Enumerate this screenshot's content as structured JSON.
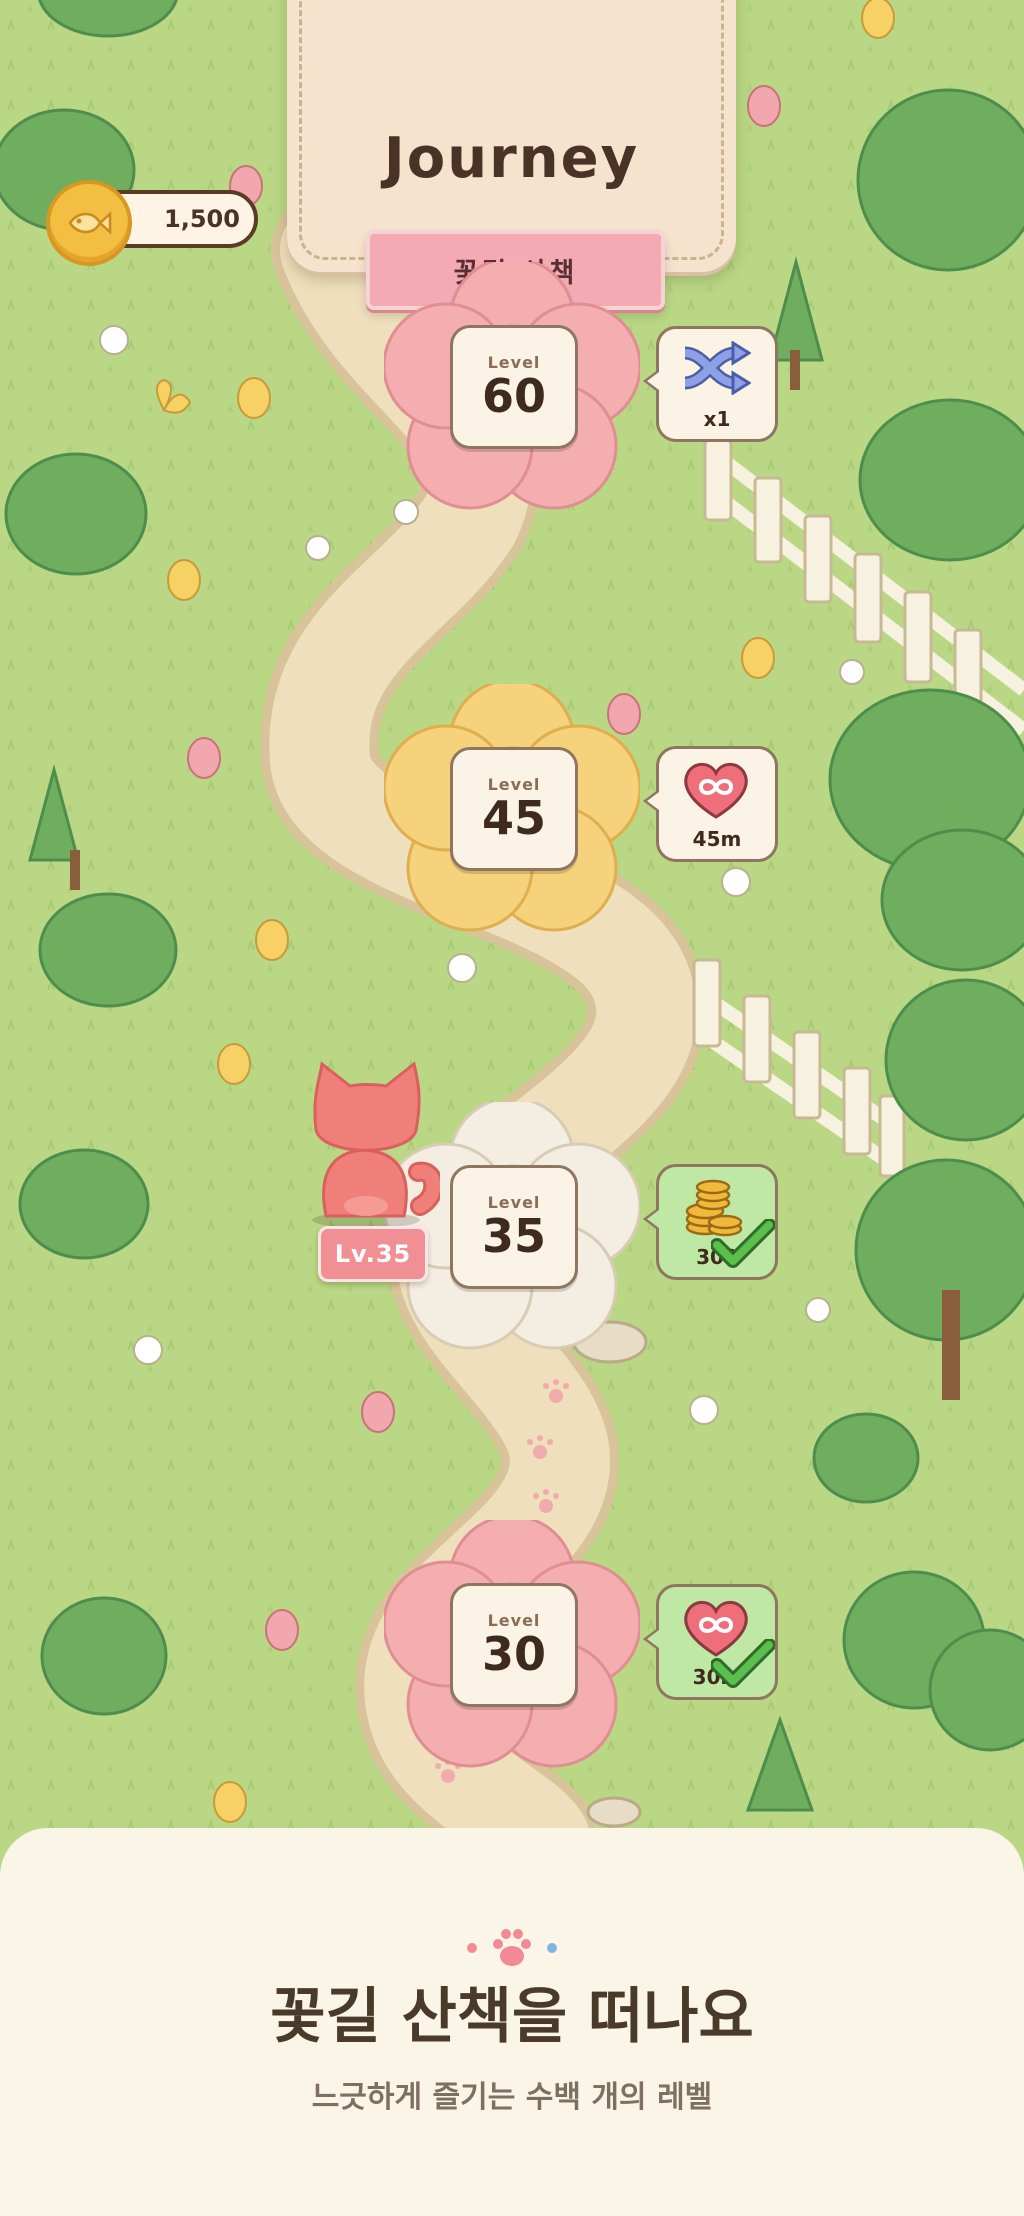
{
  "header": {
    "title": "Journey",
    "subtitle": "꽃길 산책"
  },
  "currency": {
    "coins": "1,500",
    "icon": "fish-coin-icon"
  },
  "levels": [
    {
      "word": "Level",
      "number": "60",
      "color": "#f5aeb0",
      "reward": {
        "icon": "shuffle-icon",
        "text": "x1",
        "claimed": false
      }
    },
    {
      "word": "Level",
      "number": "45",
      "color": "#f7d27c",
      "reward": {
        "icon": "infinite-heart-icon",
        "text": "45m",
        "claimed": false
      }
    },
    {
      "word": "Level",
      "number": "35",
      "color": "#f4eee2",
      "reward": {
        "icon": "coin-stack-icon",
        "text": "300",
        "claimed": true
      }
    },
    {
      "word": "Level",
      "number": "30",
      "color": "#f5aeb0",
      "reward": {
        "icon": "infinite-heart-icon",
        "text": "30m",
        "claimed": true
      }
    }
  ],
  "player": {
    "badge": "Lv.35"
  },
  "promo": {
    "title": "꽃길 산책을 떠나요",
    "subtitle": "느긋하게 즐기는 수백 개의 레벨"
  },
  "colors": {
    "grass": "#b9d784",
    "path": "#ecd9b4",
    "sheet": "#fbf5e8",
    "cat": "#f07f7a",
    "claimed_bubble": "#bfe8a5",
    "bubble": "#fbf4e6"
  }
}
